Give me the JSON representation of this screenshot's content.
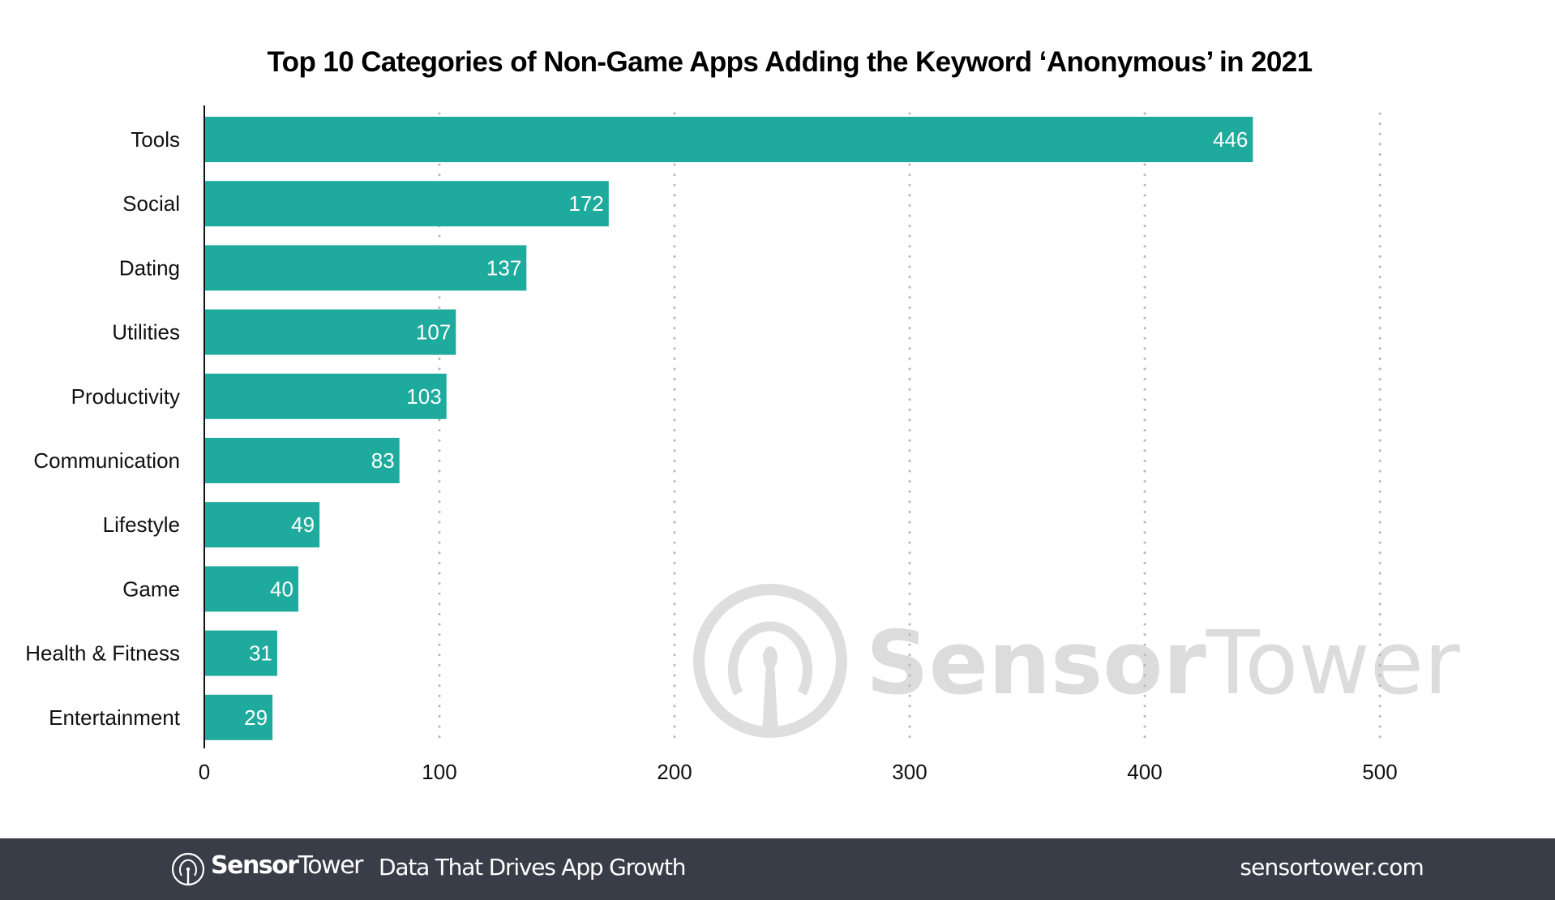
{
  "chart_data": {
    "type": "bar",
    "orientation": "horizontal",
    "title": "Top 10 Categories of Non-Game Apps Adding the Keyword ‘Anonymous’ in 2021",
    "categories": [
      "Tools",
      "Social",
      "Dating",
      "Utilities",
      "Productivity",
      "Communication",
      "Lifestyle",
      "Game",
      "Health & Fitness",
      "Entertainment"
    ],
    "values": [
      446,
      172,
      137,
      107,
      103,
      83,
      49,
      40,
      31,
      29
    ],
    "value_labels": [
      "446",
      "172",
      "137",
      "107",
      "103",
      "83",
      "49",
      "40",
      "31",
      "29"
    ],
    "xlabel": "",
    "ylabel": "",
    "xlim": [
      0,
      500
    ],
    "xticks": [
      0,
      100,
      200,
      300,
      400,
      500
    ],
    "xtick_labels": [
      "0",
      "100",
      "200",
      "300",
      "400",
      "500"
    ],
    "grid": "vertical dotted",
    "legend": "none",
    "bar_color": "#1eaa9c"
  },
  "watermark": {
    "brand_bold": "Sensor",
    "brand_light": "Tower"
  },
  "footer": {
    "brand_bold": "Sensor",
    "brand_light": "Tower",
    "tagline": "Data That Drives App Growth",
    "url": "sensortower.com",
    "background": "#393d48"
  }
}
